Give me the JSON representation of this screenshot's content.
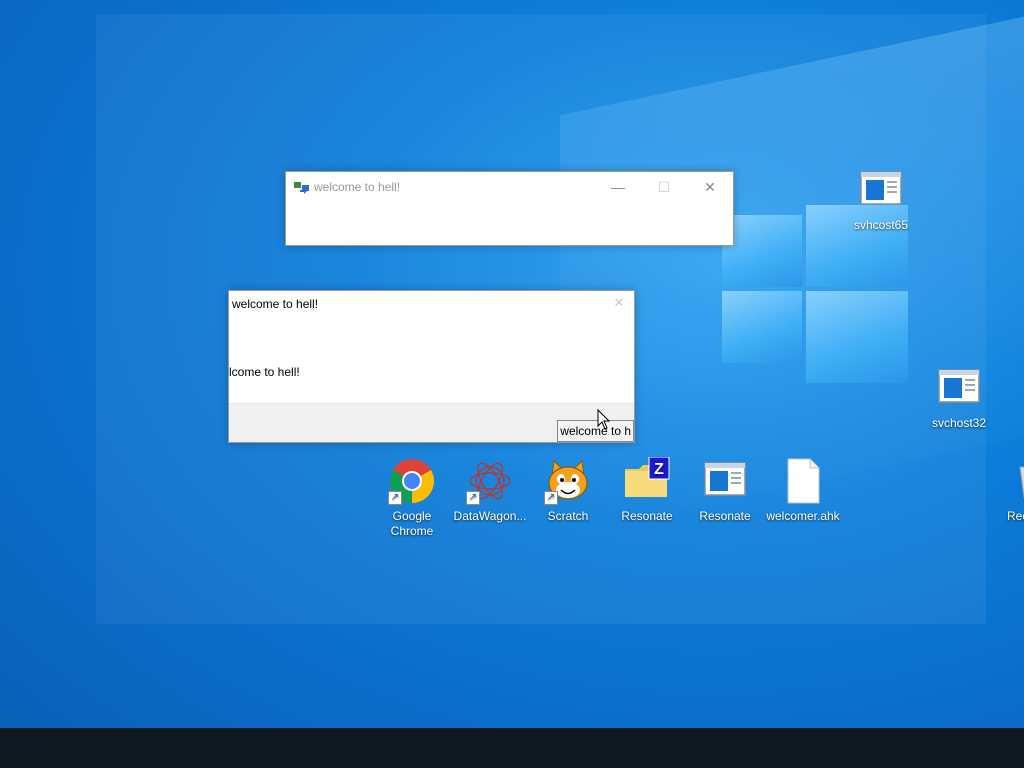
{
  "desktop": {
    "icons": [
      {
        "label": "svhcost65"
      },
      {
        "label": "svchost32"
      },
      {
        "label": "Google Chrome"
      },
      {
        "label": "DataWagon..."
      },
      {
        "label": "Scratch"
      },
      {
        "label": "Resonate"
      },
      {
        "label": "Resonate"
      },
      {
        "label": "welcomer.ahk"
      },
      {
        "label": "Rec"
      }
    ]
  },
  "window1": {
    "title": "welcome to hell!",
    "minimize_icon": "—",
    "maximize_icon": "☐",
    "close_icon": "✕"
  },
  "window2": {
    "title": "welcome to hell!",
    "close_icon": "✕",
    "body_text": "lcome to hell!",
    "status_button": "welcome to h"
  },
  "colors": {
    "desktop_bg": "#0d7fdb",
    "taskbar": "#101820",
    "window_bg": "#ffffff"
  }
}
